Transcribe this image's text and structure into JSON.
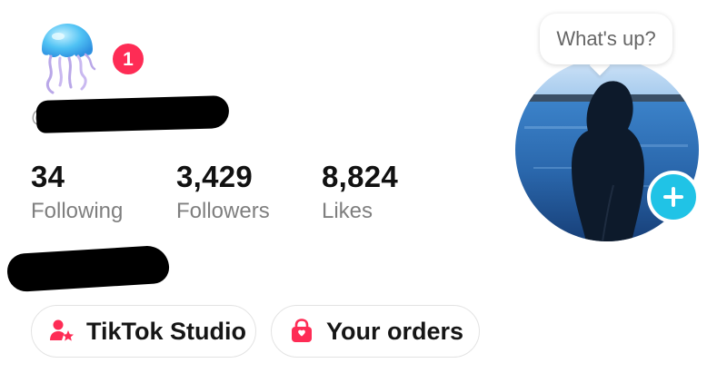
{
  "profile": {
    "notification_count": "1",
    "username_prefix": "@"
  },
  "stats": [
    {
      "value": "34",
      "label": "Following"
    },
    {
      "value": "3,429",
      "label": "Followers"
    },
    {
      "value": "8,824",
      "label": "Likes"
    }
  ],
  "buttons": {
    "studio_label": "TikTok Studio",
    "orders_label": "Your orders"
  },
  "status_bubble": "What's up?",
  "icons": {
    "avatar_icon": "jellyfish-icon",
    "add": "plus-icon",
    "studio": "person-star-icon",
    "orders": "shopping-bag-icon"
  },
  "colors": {
    "badge": "#fe2c55",
    "add_button": "#20c3e6",
    "stat_label": "#7f7f7f"
  }
}
